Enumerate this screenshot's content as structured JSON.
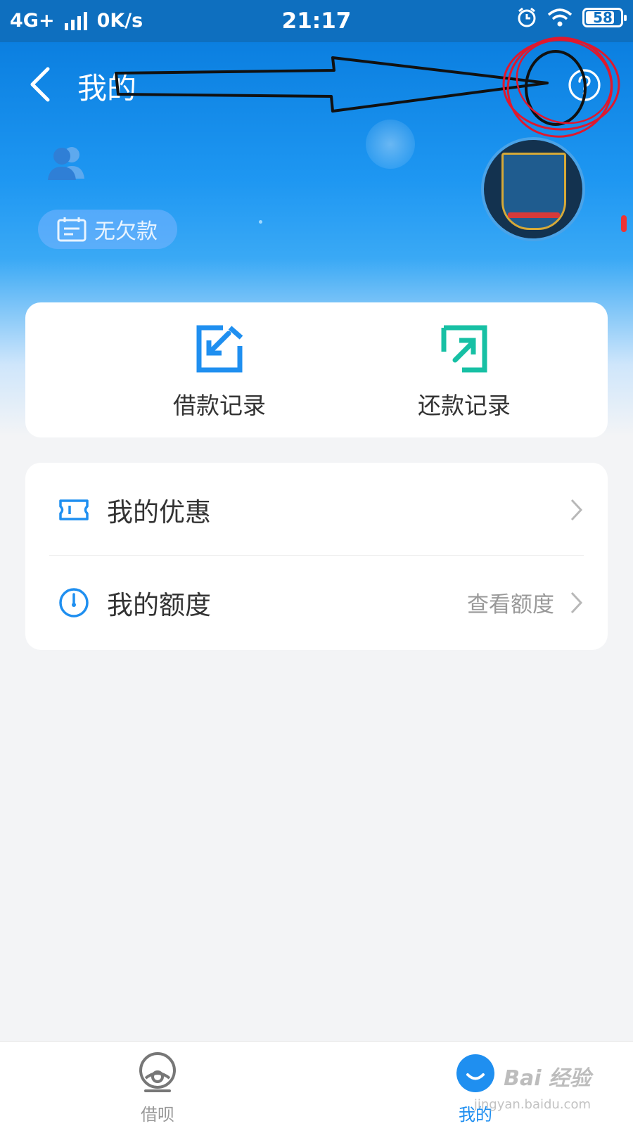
{
  "status_bar": {
    "network": "4G+",
    "speed": "0K/s",
    "time": "21:17",
    "battery": "58"
  },
  "header": {
    "title": "我的"
  },
  "profile": {
    "badge_label": "无欠款"
  },
  "records": {
    "borrow_label": "借款记录",
    "repay_label": "还款记录"
  },
  "menu": {
    "coupons_label": "我的优惠",
    "quota_label": "我的额度",
    "quota_hint": "查看额度"
  },
  "tabs": {
    "jiebei_label": "借呗",
    "mine_label": "我的"
  },
  "watermark": {
    "brand": "Bai 经验",
    "url": "jingyan.baidu.com"
  },
  "colors": {
    "accent": "#1f8ff0",
    "status_bar": "#0e6fbf",
    "repay_icon": "#17c0a4",
    "annotation_red": "#e0182d"
  }
}
